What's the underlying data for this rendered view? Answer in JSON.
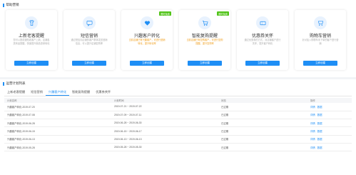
{
  "marketing": {
    "title": "帮助营销",
    "cards": [
      {
        "title": "上新老客提醒",
        "desc": "您可以提前通知老客户上新，店铺各类商品提醒，快速提升新品首单转化",
        "button": "立即创建",
        "icon": "tshirt-icon"
      },
      {
        "title": "短信营销",
        "desc": "通过短信向店铺的客户群体发送营销信息，可以提升店铺复购率",
        "button": "立即创建",
        "icon": "message-icon"
      },
      {
        "title": "兴趣客户转化",
        "desc": "当前店铺已有兴趣客户，可进行营销转化，提升转化率",
        "button": "立即创建",
        "icon": "heart-icon",
        "tag": "限时免费",
        "highlight": true
      },
      {
        "title": "智能复购提醒",
        "desc": "当前店铺已有复购客户，可进行复购提醒，提升复购率",
        "button": "立即创建",
        "icon": "cart-icon",
        "tag": "限时免费",
        "highlight": true
      },
      {
        "title": "优惠券关怀",
        "desc": "通过优惠券的方式，对店铺客户进行关怀，提升客户转化",
        "button": "立即创建",
        "icon": "coupon-icon"
      },
      {
        "title": "购物车营销",
        "desc": "针对加入购物车未下单的客户进行营销",
        "button": "立即创建",
        "icon": "shopping-cart-icon"
      }
    ]
  },
  "plans": {
    "title": "运营计划列表",
    "tabs": [
      "上新老客提醒",
      "短信营销",
      "兴趣客户转化",
      "智能复购提醒",
      "优惠券关怀"
    ],
    "active_tab": 2,
    "columns": [
      "计划名称",
      "计划时间",
      "状态",
      "操作"
    ],
    "rows": [
      {
        "name": "兴趣客户转化-2019-07-20",
        "time": "2019-07-21 ~ 2019-07-22",
        "status": "已过期"
      },
      {
        "name": "兴趣客户转化-2019-07-08",
        "time": "2019-07-09 ~ 2019-07-11",
        "status": "已过期"
      },
      {
        "name": "兴趣客户转化-2019-06-28",
        "time": "2019-06-28 ~ 2019-06-30",
        "status": "已过期"
      },
      {
        "name": "兴趣客户转化-2019-06-15",
        "time": "2019-06-15 ~ 2019-06-17",
        "status": "已过期"
      },
      {
        "name": "兴趣客户转化-2019-06-13",
        "time": "2019-06-13 ~ 2019-06-13",
        "status": "已过期"
      },
      {
        "name": "兴趣客户转化-2019-05-28",
        "time": "2019-05-28 ~ 2019-05-30",
        "status": "已过期"
      }
    ],
    "actions": [
      "详情",
      "数据"
    ]
  }
}
